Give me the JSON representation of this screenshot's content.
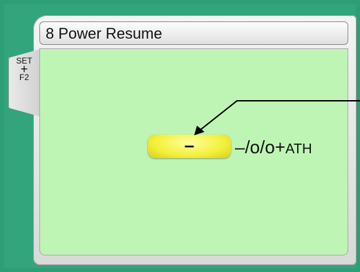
{
  "side_tab": {
    "line1": "SET",
    "line2": "+",
    "line3": "F2"
  },
  "title": "8 Power Resume",
  "value": "–",
  "options": {
    "main": "–/o/o+",
    "suffix": "ATH"
  }
}
